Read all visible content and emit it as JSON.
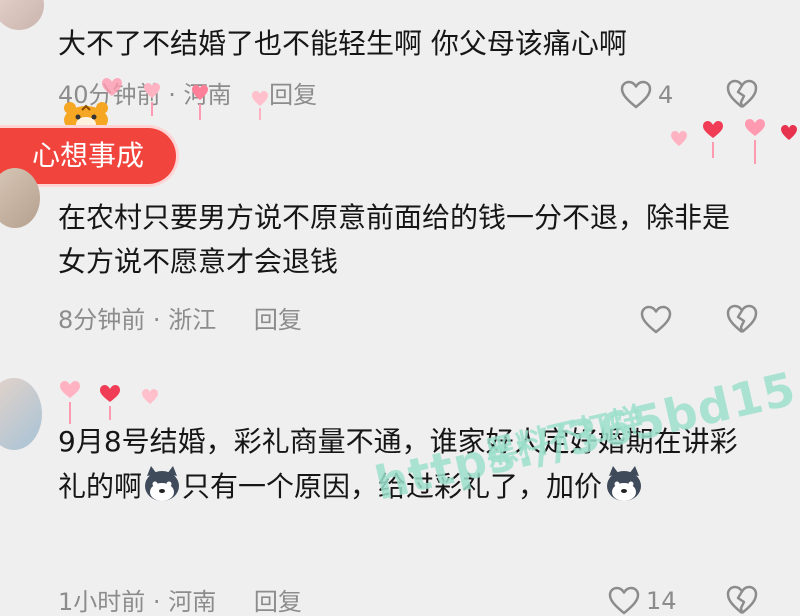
{
  "comments": [
    {
      "text": "大不了不结婚了也不能轻生啊 你父母该痛心啊",
      "time": "40分钟前",
      "location": "河南",
      "reply": "回复",
      "likes": "4"
    },
    {
      "text": "在农村只要男方说不原意前面给的钱一分不退，除非是女方说不愿意才会退钱",
      "time": "8分钟前",
      "location": "浙江",
      "reply": "回复",
      "likes": ""
    },
    {
      "text_part1": "9月8号结婚，彩礼商量不通，谁家好人定好婚期在讲彩礼的啊",
      "text_part2": "只有一个原因，给过彩礼了，加价",
      "time": "1小时前",
      "location": "河南",
      "reply": "回复",
      "likes": "14"
    }
  ],
  "badge": {
    "label": "心想事成"
  },
  "separator": "·",
  "watermark": {
    "line1": "黑料不打烊",
    "line2": "https://365bd15.com"
  },
  "icons": {
    "like": "heart-outline-icon",
    "dislike": "broken-heart-icon",
    "emoji": "husky-dog-emoji-icon"
  },
  "colors": {
    "text": "#161616",
    "meta": "#8c8c8c",
    "badge": "#f0443d",
    "watermark": "#9de0cc"
  }
}
